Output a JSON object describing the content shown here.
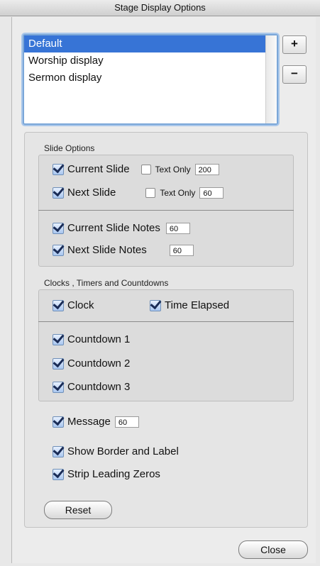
{
  "window": {
    "title": "Stage Display Options"
  },
  "displays": {
    "items": [
      "Default",
      "Worship display",
      "Sermon display"
    ],
    "selected_index": 0,
    "add_label": "+",
    "remove_label": "−"
  },
  "slide_options": {
    "title": "Slide Options",
    "current_slide": {
      "label": "Current Slide",
      "checked": true,
      "text_only_label": "Text Only",
      "text_only_checked": false,
      "value": "200"
    },
    "next_slide": {
      "label": "Next Slide",
      "checked": true,
      "text_only_label": "Text Only",
      "text_only_checked": false,
      "value": "60"
    },
    "current_slide_notes": {
      "label": "Current Slide Notes",
      "checked": true,
      "value": "60"
    },
    "next_slide_notes": {
      "label": "Next Slide Notes",
      "checked": true,
      "value": "60"
    }
  },
  "clocks": {
    "title": "Clocks , Timers and Countdowns",
    "clock": {
      "label": "Clock",
      "checked": true
    },
    "time_elapsed": {
      "label": "Time Elapsed",
      "checked": true
    },
    "countdown1": {
      "label": "Countdown 1",
      "checked": true
    },
    "countdown2": {
      "label": "Countdown 2",
      "checked": true
    },
    "countdown3": {
      "label": "Countdown 3",
      "checked": true
    }
  },
  "misc": {
    "message": {
      "label": "Message",
      "checked": true,
      "value": "60"
    },
    "show_border": {
      "label": "Show Border and Label",
      "checked": true
    },
    "strip_zeros": {
      "label": "Strip Leading Zeros",
      "checked": true
    }
  },
  "buttons": {
    "reset": "Reset",
    "close": "Close"
  }
}
